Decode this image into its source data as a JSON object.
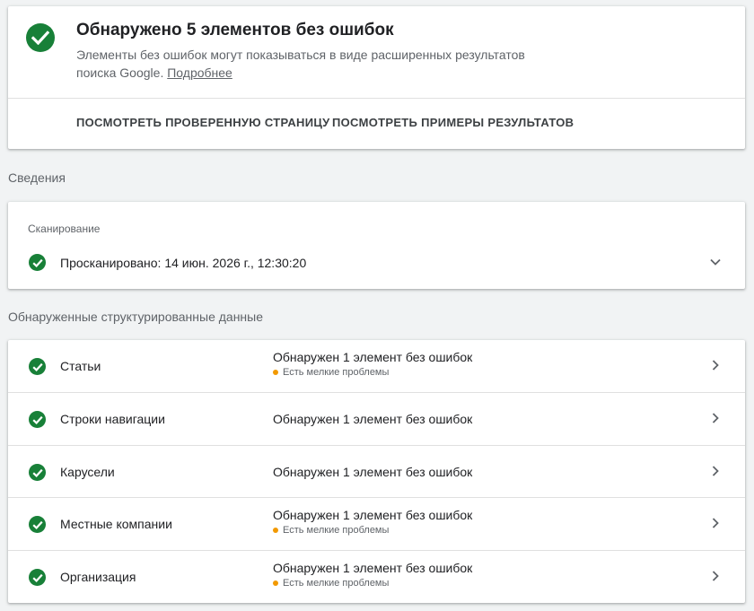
{
  "colors": {
    "success": "#188038",
    "warning": "#f29900"
  },
  "summary": {
    "icon": "check-circle-icon",
    "title": "Обнаружено 5 элементов без ошибок",
    "description": "Элементы без ошибок могут показываться в виде расширенных результатов поиска Google.",
    "learn_more": "Подробнее",
    "actions": {
      "view_page": "ПОСМОТРЕТЬ ПРОВЕРЕННУЮ СТРАНИЦУ",
      "view_results": "ПОСМОТРЕТЬ ПРИМЕРЫ РЕЗУЛЬТАТОВ"
    }
  },
  "details": {
    "heading": "Сведения",
    "crawl": {
      "label": "Сканирование",
      "status": "Просканировано: 14 июн. 2026 г., 12:30:20",
      "icon": "check-circle-icon",
      "expand_icon": "chevron-down-icon"
    }
  },
  "structured_data": {
    "heading": "Обнаруженные структурированные данные",
    "items": [
      {
        "name": "Статьи",
        "status": "Обнаружен 1 элемент без ошибок",
        "issue": "Есть мелкие проблемы"
      },
      {
        "name": "Строки навигации",
        "status": "Обнаружен 1 элемент без ошибок",
        "issue": ""
      },
      {
        "name": "Карусели",
        "status": "Обнаружен 1 элемент без ошибок",
        "issue": ""
      },
      {
        "name": "Местные компании",
        "status": "Обнаружен 1 элемент без ошибок",
        "issue": "Есть мелкие проблемы"
      },
      {
        "name": "Организация",
        "status": "Обнаружен 1 элемент без ошибок",
        "issue": "Есть мелкие проблемы"
      }
    ]
  }
}
